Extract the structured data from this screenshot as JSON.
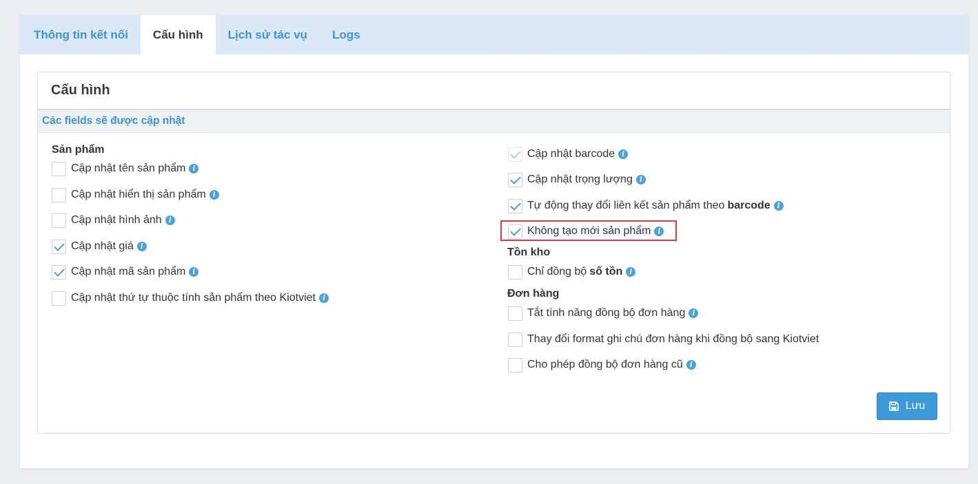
{
  "tabs": [
    {
      "label": "Thông tin kết nối",
      "active": false
    },
    {
      "label": "Cấu hình",
      "active": true
    },
    {
      "label": "Lịch sử tác vụ",
      "active": false
    },
    {
      "label": "Logs",
      "active": false
    }
  ],
  "panel": {
    "title": "Cấu hình",
    "section_title": "Các fields sẽ được cập nhật"
  },
  "left": {
    "group_title": "Sản phẩm",
    "items": [
      {
        "label": "Cập nhật tên sản phẩm",
        "checked": false,
        "info": true
      },
      {
        "label": "Cập nhật hiển thị sản phẩm",
        "checked": false,
        "info": true
      },
      {
        "label": "Cập nhật hình ảnh",
        "checked": false,
        "info": true
      },
      {
        "label": "Cập nhật giá",
        "checked": true,
        "info": true
      },
      {
        "label": "Cập nhật mã sản phẩm",
        "checked": true,
        "info": true
      },
      {
        "label": "Cập nhật thứ tự thuộc tính sản phẩm theo Kiotviet",
        "checked": false,
        "info": true
      }
    ]
  },
  "right": {
    "items": [
      {
        "label": "Cập nhật barcode",
        "checked": true,
        "disabled": true,
        "info": true
      },
      {
        "label": "Cập nhật trọng lượng",
        "checked": true,
        "info": true
      },
      {
        "label": "Tự động thay đổi liên kết sản phẩm theo",
        "bold": "barcode",
        "checked": true,
        "info": true
      },
      {
        "label": "Không tạo mới sản phẩm",
        "checked": true,
        "info": true,
        "highlighted": true
      }
    ],
    "inventory_title": "Tồn kho",
    "inventory_items": [
      {
        "label": "Chỉ đồng bộ",
        "bold": "số tồn",
        "checked": false,
        "info": true
      }
    ],
    "orders_title": "Đơn hàng",
    "order_items": [
      {
        "label": "Tắt tính năng đồng bộ đơn hàng",
        "checked": false,
        "info": true
      },
      {
        "label": "Thay đổi format ghi chú đơn hàng khi đồng bộ sang Kiotviet",
        "checked": false,
        "info": false
      },
      {
        "label": "Cho phép đồng bộ đơn hàng cũ",
        "checked": false,
        "info": true
      }
    ]
  },
  "save_button": {
    "label": "Lưu",
    "icon": "floppy-disk-icon"
  },
  "colors": {
    "accent": "#3b93d6",
    "tab_bar": "#dbe8f6",
    "highlight": "#e03a3a",
    "button": "#3d9ad9"
  }
}
